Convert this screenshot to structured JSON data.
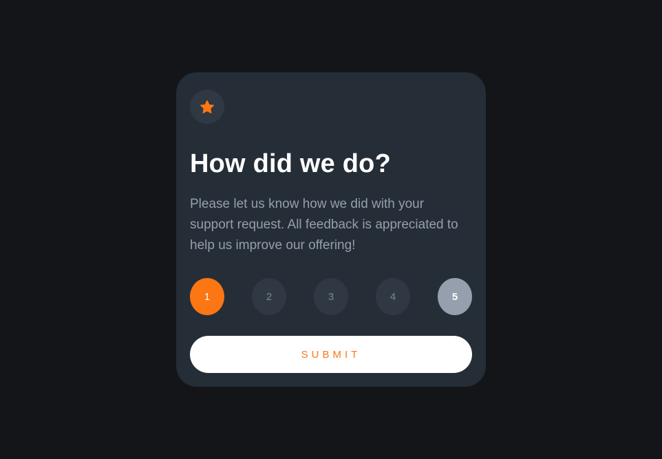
{
  "colors": {
    "background": "#131518",
    "card": "#252d37",
    "accent": "#fc7614",
    "muted": "#969fad",
    "circle": "#2f3843"
  },
  "header": {
    "icon": "star-icon",
    "title": "How did we do?"
  },
  "description": "Please let us know how we did with your support request. All feedback is appreciated to help us improve our offering!",
  "ratings": {
    "options": [
      "1",
      "2",
      "3",
      "4",
      "5"
    ],
    "selected": "1",
    "hovered": "5"
  },
  "submit_label": "SUBMIT"
}
